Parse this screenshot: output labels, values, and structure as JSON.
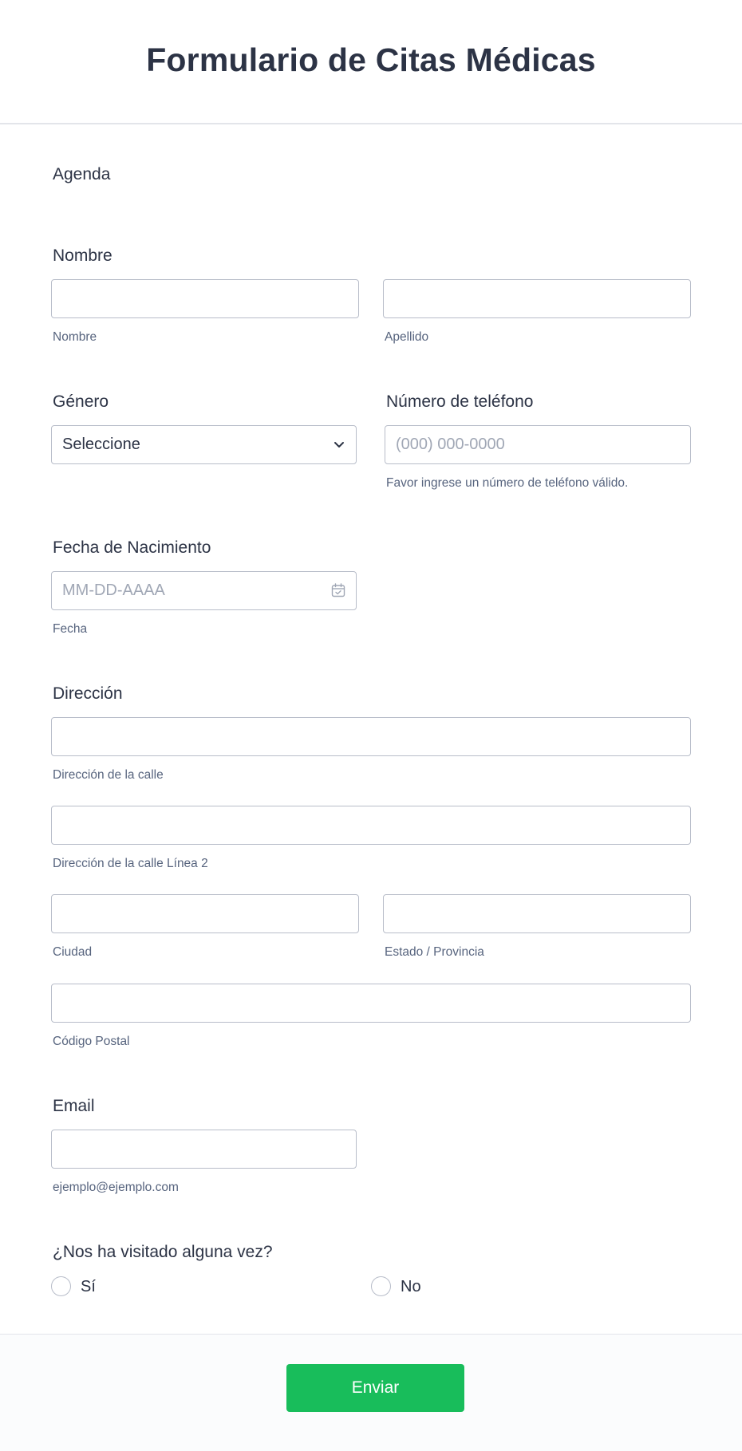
{
  "form": {
    "title": "Formulario de Citas Médicas",
    "section_agenda": "Agenda",
    "name": {
      "label": "Nombre",
      "first_sublabel": "Nombre",
      "last_sublabel": "Apellido"
    },
    "gender": {
      "label": "Género",
      "selected": "Seleccione"
    },
    "phone": {
      "label": "Número de teléfono",
      "placeholder": "(000) 000-0000",
      "hint": "Favor ingrese un número de teléfono válido."
    },
    "birthdate": {
      "label": "Fecha de Nacimiento",
      "placeholder": "MM-DD-AAAA",
      "sublabel": "Fecha"
    },
    "address": {
      "label": "Dirección",
      "street_sublabel": "Dirección de la calle",
      "street2_sublabel": "Dirección de la calle Línea 2",
      "city_sublabel": "Ciudad",
      "state_sublabel": "Estado / Provincia",
      "postal_sublabel": "Código Postal"
    },
    "email": {
      "label": "Email",
      "sublabel": "ejemplo@ejemplo.com"
    },
    "visited": {
      "label": "¿Nos ha visitado alguna vez?",
      "options": [
        "Sí",
        "No"
      ]
    },
    "submit_label": "Enviar"
  },
  "colors": {
    "accent": "#18bd5b",
    "text": "#2c3345",
    "sublabel": "#57647e",
    "border": "#b8bdc9"
  }
}
